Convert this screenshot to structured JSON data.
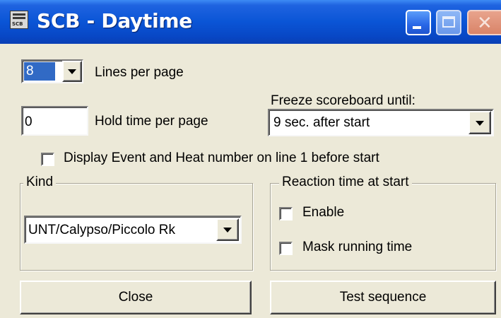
{
  "window": {
    "title": "SCB - Daytime",
    "icon_caption": "SCB",
    "controls": {
      "minimize": "minimize-icon",
      "maximize": "maximize-icon",
      "close": "close-icon"
    },
    "colors": {
      "titlebar": "#0a55d6",
      "face": "#ece9d8"
    }
  },
  "lines_per_page": {
    "value": "8",
    "label": "Lines per page"
  },
  "hold_time": {
    "value": "0",
    "label": "Hold time per page"
  },
  "freeze": {
    "label": "Freeze scoreboard until:",
    "value": "9 sec. after start"
  },
  "display_event_heat": {
    "label": "Display Event and Heat number on line 1 before start",
    "checked": false
  },
  "kind": {
    "title": "Kind",
    "value": "UNT/Calypso/Piccolo Rk"
  },
  "reaction": {
    "title": "Reaction time at start",
    "enable": {
      "label": "Enable",
      "checked": false
    },
    "mask": {
      "label": "Mask running time",
      "checked": false
    }
  },
  "buttons": {
    "close": "Close",
    "test": "Test sequence"
  }
}
